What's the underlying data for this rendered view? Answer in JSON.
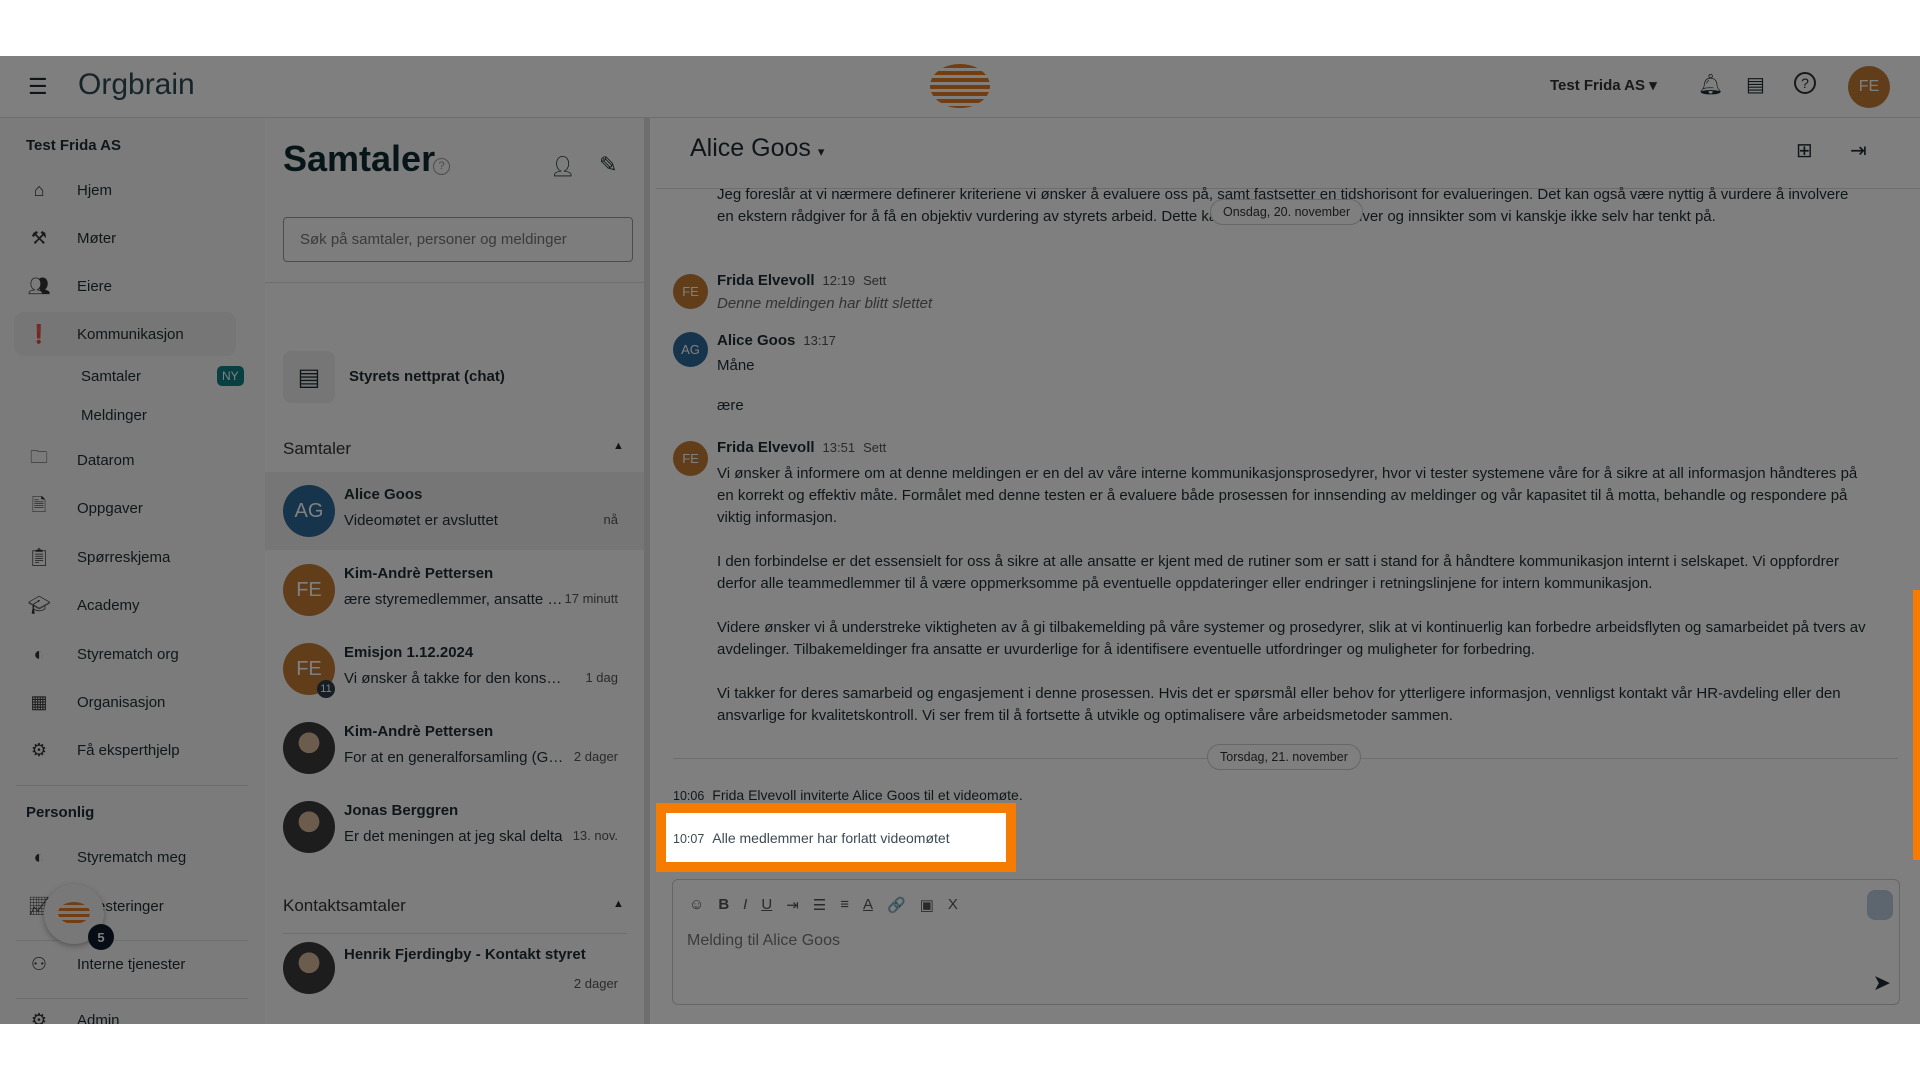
{
  "header": {
    "brand": "Orgbrain",
    "org_selector": "Test Frida AS",
    "user_initials": "FE",
    "icons": [
      "menu-icon",
      "bell-icon",
      "chat-icon",
      "help-icon"
    ]
  },
  "sidebar": {
    "org": "Test Frida AS",
    "items": [
      {
        "label": "Hjem",
        "icon": "home-icon"
      },
      {
        "label": "Møter",
        "icon": "gavel-icon"
      },
      {
        "label": "Eiere",
        "icon": "people-icon"
      },
      {
        "label": "Kommunikasjon",
        "icon": "alert-chat-icon"
      }
    ],
    "sub_items": [
      {
        "label": "Samtaler",
        "badge": "NY"
      },
      {
        "label": "Meldinger"
      }
    ],
    "items2": [
      {
        "label": "Datarom",
        "icon": "folder-icon"
      },
      {
        "label": "Oppgaver",
        "icon": "task-icon"
      },
      {
        "label": "Spørreskjema",
        "icon": "survey-icon"
      },
      {
        "label": "Academy",
        "icon": "school-icon"
      },
      {
        "label": "Styrematch org",
        "icon": "match-icon"
      },
      {
        "label": "Organisasjon",
        "icon": "building-icon"
      },
      {
        "label": "Få eksperthjelp",
        "icon": "expert-icon"
      }
    ],
    "personal_heading": "Personlig",
    "items3": [
      {
        "label": "Styrematch meg",
        "icon": "match-icon"
      },
      {
        "label": "Investeringer",
        "icon": "chart-icon"
      },
      {
        "label": "Interne tjenester",
        "icon": "services-icon"
      },
      {
        "label": "Admin",
        "icon": "admin-icon"
      }
    ],
    "fab_badge": "5"
  },
  "list": {
    "title": "Samtaler",
    "search_placeholder": "Søk på samtaler, personer og meldinger",
    "board_chat": "Styrets nettprat (chat)",
    "section1": "Samtaler",
    "section2": "Kontaktsamtaler",
    "conversations": [
      {
        "name": "Alice Goos",
        "preview": "Videomøtet er avsluttet",
        "time": "nå",
        "initials": "AG",
        "color": "#2d6a99"
      },
      {
        "name": "Kim-Andrè Pettersen",
        "preview": "ære styremedlemmer, ansatte og interessenter",
        "time": "17 minutt",
        "initials": "FE",
        "color": "#c47a35"
      },
      {
        "name": "Emisjon 1.12.2024",
        "preview": "Vi ønsker å takke for den konstruktive",
        "time": "1 dag",
        "initials": "FE",
        "color": "#c47a35",
        "badge": "11"
      },
      {
        "name": "Kim-Andrè Pettersen",
        "preview": "For at en generalforsamling (GF) skal",
        "time": "2 dager"
      },
      {
        "name": "Jonas Berggren",
        "preview": "Er det meningen at jeg skal delta",
        "time": "13. nov."
      }
    ],
    "contacts": [
      {
        "name": "Henrik Fjerdingby - Kontakt styret",
        "time": "2 dager"
      }
    ]
  },
  "chat": {
    "title": "Alice Goos",
    "top_lines": [
      "Jeg foreslår at vi nærmere definerer kriteriene vi ønsker å evaluere oss på, samt fastsetter en tidshorisont for evalueringen. Det kan også være nyttig å vurdere å involvere",
      "en ekstern rådgiver for å få en objektiv vurdering av styrets arbeid. Dette kan gi oss nye perspektiver og innsikter som vi kanskje ikke selv har tenkt på."
    ],
    "date1": "Onsdag, 20. november",
    "m1": {
      "author": "Frida Elvevoll",
      "time": "12:19",
      "status": "Sett",
      "text": "Denne meldingen har blitt slettet",
      "initials": "FE"
    },
    "m2": {
      "author": "Alice Goos",
      "time": "13:17",
      "lines": [
        "Måne",
        "ære"
      ],
      "initials": "AG"
    },
    "m3": {
      "author": "Frida Elvevoll",
      "time": "13:51",
      "status": "Sett",
      "initials": "FE",
      "paragraphs": [
        "Vi ønsker å informere om at denne meldingen er en del av våre interne kommunikasjonsprosedyrer, hvor vi tester systemene våre for å sikre at all informasjon håndteres på en korrekt og effektiv måte. Formålet med denne testen er å evaluere både prosessen for innsending av meldinger og vår kapasitet til å motta, behandle og respondere på viktig informasjon.",
        "I den forbindelse er det essensielt for oss å sikre at alle ansatte er kjent med de rutiner som er satt i stand for å håndtere kommunikasjon internt i selskapet. Vi oppfordrer derfor alle teammedlemmer til å være oppmerksomme på eventuelle oppdateringer eller endringer i retningslinjene for intern kommunikasjon.",
        "Videre ønsker vi å understreke viktigheten av å gi tilbakemelding på våre systemer og prosedyrer, slik at vi kontinuerlig kan forbedre arbeidsflyten og samarbeidet på tvers av avdelinger. Tilbakemeldinger fra ansatte er uvurderlige for å identifisere eventuelle utfordringer og muligheter for forbedring.",
        "Vi takker for deres samarbeid og engasjement i denne prosessen. Hvis det er spørsmål eller behov for ytterligere informasjon, vennligst kontakt vår HR-avdeling eller den ansvarlige for kvalitetskontroll. Vi ser frem til å fortsette å utvikle og optimalisere våre arbeidsmetoder sammen."
      ]
    },
    "date2": "Torsdag, 21. november",
    "e1": {
      "time": "10:06",
      "text": "Frida Elvevoll inviterte Alice Goos til et videomøte."
    },
    "e2": {
      "time": "10:07",
      "text": "Alle medlemmer har forlatt videomøtet"
    },
    "composer_placeholder": "Melding til Alice Goos",
    "toolbar": [
      "☺",
      "B",
      "I",
      "U",
      "⇥",
      "☰",
      "≡",
      "A",
      "🔗",
      "▣",
      "X"
    ]
  },
  "colors": {
    "accent": "#f57c00",
    "highlight_border": "#f57c00",
    "badge": "#0f7f86"
  }
}
